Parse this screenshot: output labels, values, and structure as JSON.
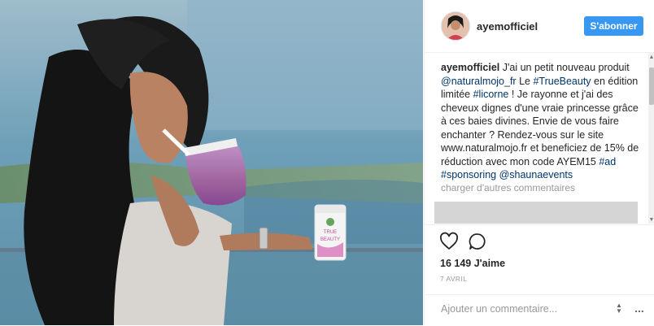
{
  "post": {
    "photo_icon_name": "post-photo",
    "jar_label_line1": "TRUE",
    "jar_label_line2": "BEAUTY"
  },
  "header": {
    "username": "ayemofficiel",
    "follow_label": "S'abonner",
    "avatar_icon": "avatar-icon"
  },
  "caption": {
    "author": "ayemofficiel",
    "segments": [
      {
        "text": "J'ai un petit nouveau produit ",
        "type": "text"
      },
      {
        "text": "@naturalmojo_fr",
        "type": "link"
      },
      {
        "text": " Le ",
        "type": "text"
      },
      {
        "text": "#TrueBeauty",
        "type": "link"
      },
      {
        "text": " en édition limitée ",
        "type": "text"
      },
      {
        "text": "#licorne",
        "type": "link"
      },
      {
        "text": " ! Je rayonne et j'ai des cheveux dignes d'une vraie princesse grâce à ces baies divines. Envie de vous faire enchanter ? Rendez-vous sur le site www.naturalmojo.fr et beneficiez de 15% de réduction avec mon code AYEM15 ",
        "type": "text"
      },
      {
        "text": "#ad",
        "type": "link"
      },
      {
        "text": " ",
        "type": "text"
      },
      {
        "text": "#sponsoring",
        "type": "link"
      },
      {
        "text": " ",
        "type": "text"
      },
      {
        "text": "@shaunaevents",
        "type": "link"
      }
    ],
    "load_more": "charger d'autres commentaires"
  },
  "actions": {
    "likes": "16 149 J'aime",
    "date": "7 AVRIL"
  },
  "comment": {
    "placeholder": "Ajouter un commentaire...",
    "more_label": "..."
  },
  "colors": {
    "accent": "#3897f0",
    "link": "#003569",
    "text": "#262626",
    "muted": "#999999"
  }
}
